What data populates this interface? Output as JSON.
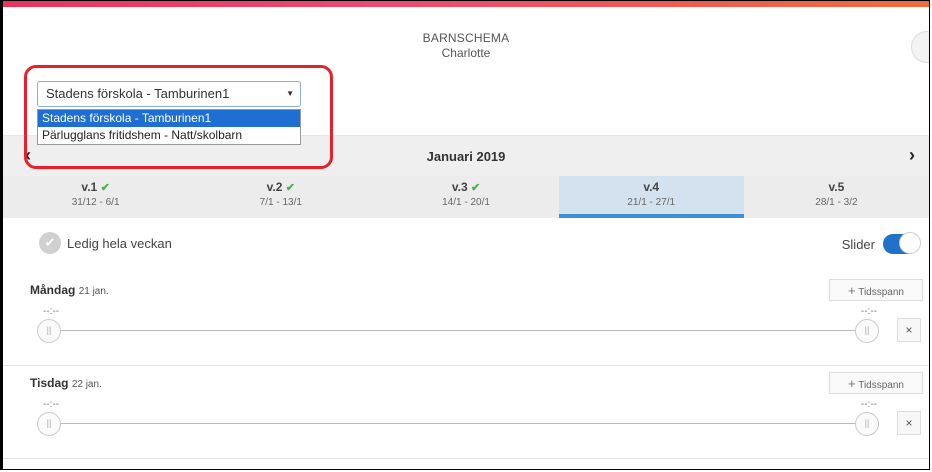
{
  "header": {
    "title": "BARNSCHEMA",
    "child": "Charlotte"
  },
  "school_select": {
    "value": "Stadens förskola - Tamburinen1",
    "options": [
      "Stadens förskola - Tamburinen1",
      "Pärlugglans fritidshem - Natt/skolbarn"
    ]
  },
  "month": {
    "label": "Januari 2019",
    "prev": "‹",
    "next": "›"
  },
  "weeks": [
    {
      "label": "v.1",
      "range": "31/12 - 6/1",
      "done": true
    },
    {
      "label": "v.2",
      "range": "7/1 - 13/1",
      "done": true
    },
    {
      "label": "v.3",
      "range": "14/1 - 20/1",
      "done": true
    },
    {
      "label": "v.4",
      "range": "21/1 - 27/1",
      "done": false
    },
    {
      "label": "v.5",
      "range": "28/1 - 3/2",
      "done": false
    }
  ],
  "ledig": {
    "label": "Ledig hela veckan"
  },
  "slider_toggle": {
    "label": "Slider"
  },
  "days": [
    {
      "name": "Måndag",
      "date": "21 jan.",
      "start": "--:--",
      "end": "--:--",
      "button": "Tidsspann"
    },
    {
      "name": "Tisdag",
      "date": "22 jan.",
      "start": "--:--",
      "end": "--:--",
      "button": "Tidsspann"
    }
  ],
  "icons": {
    "check": "✔",
    "plus": "+",
    "close": "×",
    "handle": "||"
  },
  "colors": {
    "accent": "#1f72c8",
    "selected_option": "#1e6fd1",
    "active_week": "#d3e2ee",
    "highlight": "#e8202a"
  }
}
